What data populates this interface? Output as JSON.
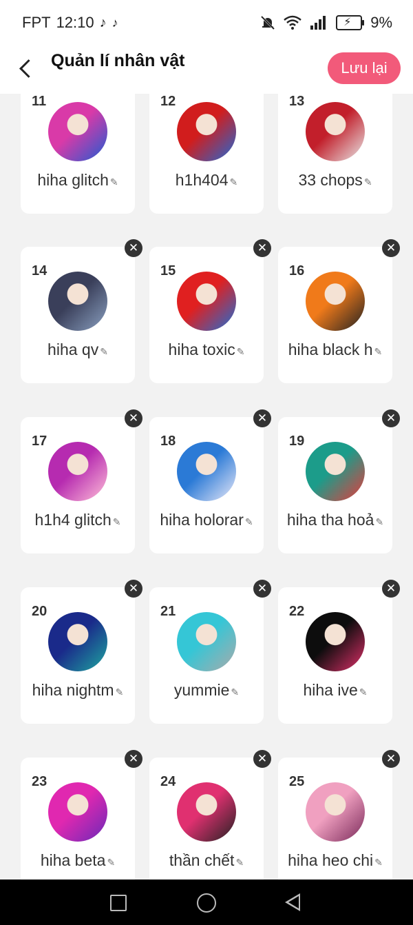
{
  "status_bar": {
    "carrier": "FPT",
    "time": "12:10",
    "app_icons": [
      "tiktok-icon",
      "tiktok-icon"
    ],
    "system_icons": [
      "mute-bell-icon",
      "wifi-icon",
      "signal-icon",
      "battery-charging-icon"
    ],
    "battery": "9%"
  },
  "header": {
    "title": "Quản lí nhân vật",
    "save_label": "Lưu lại",
    "accent_color": "#f25a7a"
  },
  "cards": [
    {
      "number": "11",
      "name": "hiha glitch",
      "avatar_colors": [
        "#d93aa8",
        "#1e5cd1"
      ]
    },
    {
      "number": "12",
      "name": "h1h404",
      "avatar_colors": [
        "#d11d1d",
        "#1f6ad6"
      ]
    },
    {
      "number": "13",
      "name": "33 chops",
      "avatar_colors": [
        "#c21f2b",
        "#e8e8e8"
      ]
    },
    {
      "number": "14",
      "name": "hiha qv",
      "avatar_colors": [
        "#3a3f5a",
        "#8aa0c0"
      ]
    },
    {
      "number": "15",
      "name": "hiha toxic",
      "avatar_colors": [
        "#e02020",
        "#1c6fd6"
      ]
    },
    {
      "number": "16",
      "name": "hiha black h",
      "avatar_colors": [
        "#f07a1a",
        "#222222"
      ]
    },
    {
      "number": "17",
      "name": "h1h4 glitch",
      "avatar_colors": [
        "#b62bb0",
        "#ffc0d8"
      ]
    },
    {
      "number": "18",
      "name": "hiha holorar",
      "avatar_colors": [
        "#2b7ad6",
        "#e8e8f8"
      ]
    },
    {
      "number": "19",
      "name": "hiha tha hoả",
      "avatar_colors": [
        "#1c9c8a",
        "#e83a3a"
      ]
    },
    {
      "number": "20",
      "name": "hiha nightm",
      "avatar_colors": [
        "#1a2a8a",
        "#1fa8a0"
      ]
    },
    {
      "number": "21",
      "name": "yummie",
      "avatar_colors": [
        "#35c6d6",
        "#aaaaaa"
      ]
    },
    {
      "number": "22",
      "name": "hiha ive",
      "avatar_colors": [
        "#0d0d0d",
        "#e0306a"
      ]
    },
    {
      "number": "23",
      "name": "hiha beta",
      "avatar_colors": [
        "#e028b0",
        "#6a2ab8"
      ]
    },
    {
      "number": "24",
      "name": "thần chết",
      "avatar_colors": [
        "#e03070",
        "#222222"
      ]
    },
    {
      "number": "25",
      "name": "hiha heo chi",
      "avatar_colors": [
        "#f0a0c0",
        "#7a2a5a"
      ]
    }
  ],
  "nav_bar": {
    "icons": [
      "recent-apps-icon",
      "home-icon",
      "back-icon"
    ]
  }
}
